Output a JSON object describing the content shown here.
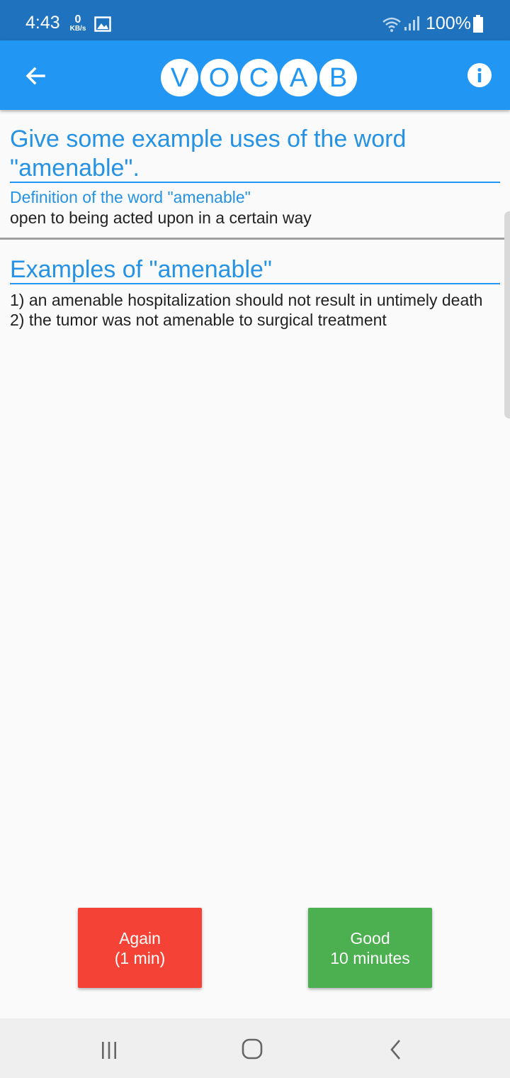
{
  "status_bar": {
    "time": "4:43",
    "net_speed_value": "0",
    "net_speed_unit": "KB/s",
    "battery": "100%",
    "icons": [
      "gallery-icon",
      "wifi-icon",
      "signal-icon",
      "battery-icon"
    ]
  },
  "app_bar": {
    "logo_letters": [
      "V",
      "O",
      "C",
      "A",
      "B"
    ],
    "icons": [
      "back-arrow-icon",
      "info-icon"
    ]
  },
  "card": {
    "question": "Give some example uses of the word \"amenable\".",
    "definition_label": "Definition of the word \"amenable\"",
    "definition_text": "open to being acted upon in a certain way",
    "examples_title": "Examples of \"amenable\"",
    "examples": [
      "1) an amenable hospitalization should not result in untimely death",
      "2) the tumor was not amenable to surgical treatment"
    ]
  },
  "buttons": {
    "again": {
      "line1": "Again",
      "line2": "(1 min)"
    },
    "good": {
      "line1": "Good",
      "line2": "10 minutes"
    }
  },
  "colors": {
    "status_bar": "#1f72bd",
    "app_bar": "#2196f3",
    "heading_text": "#2592e3",
    "again_button": "#f44336",
    "good_button": "#4caf50"
  }
}
